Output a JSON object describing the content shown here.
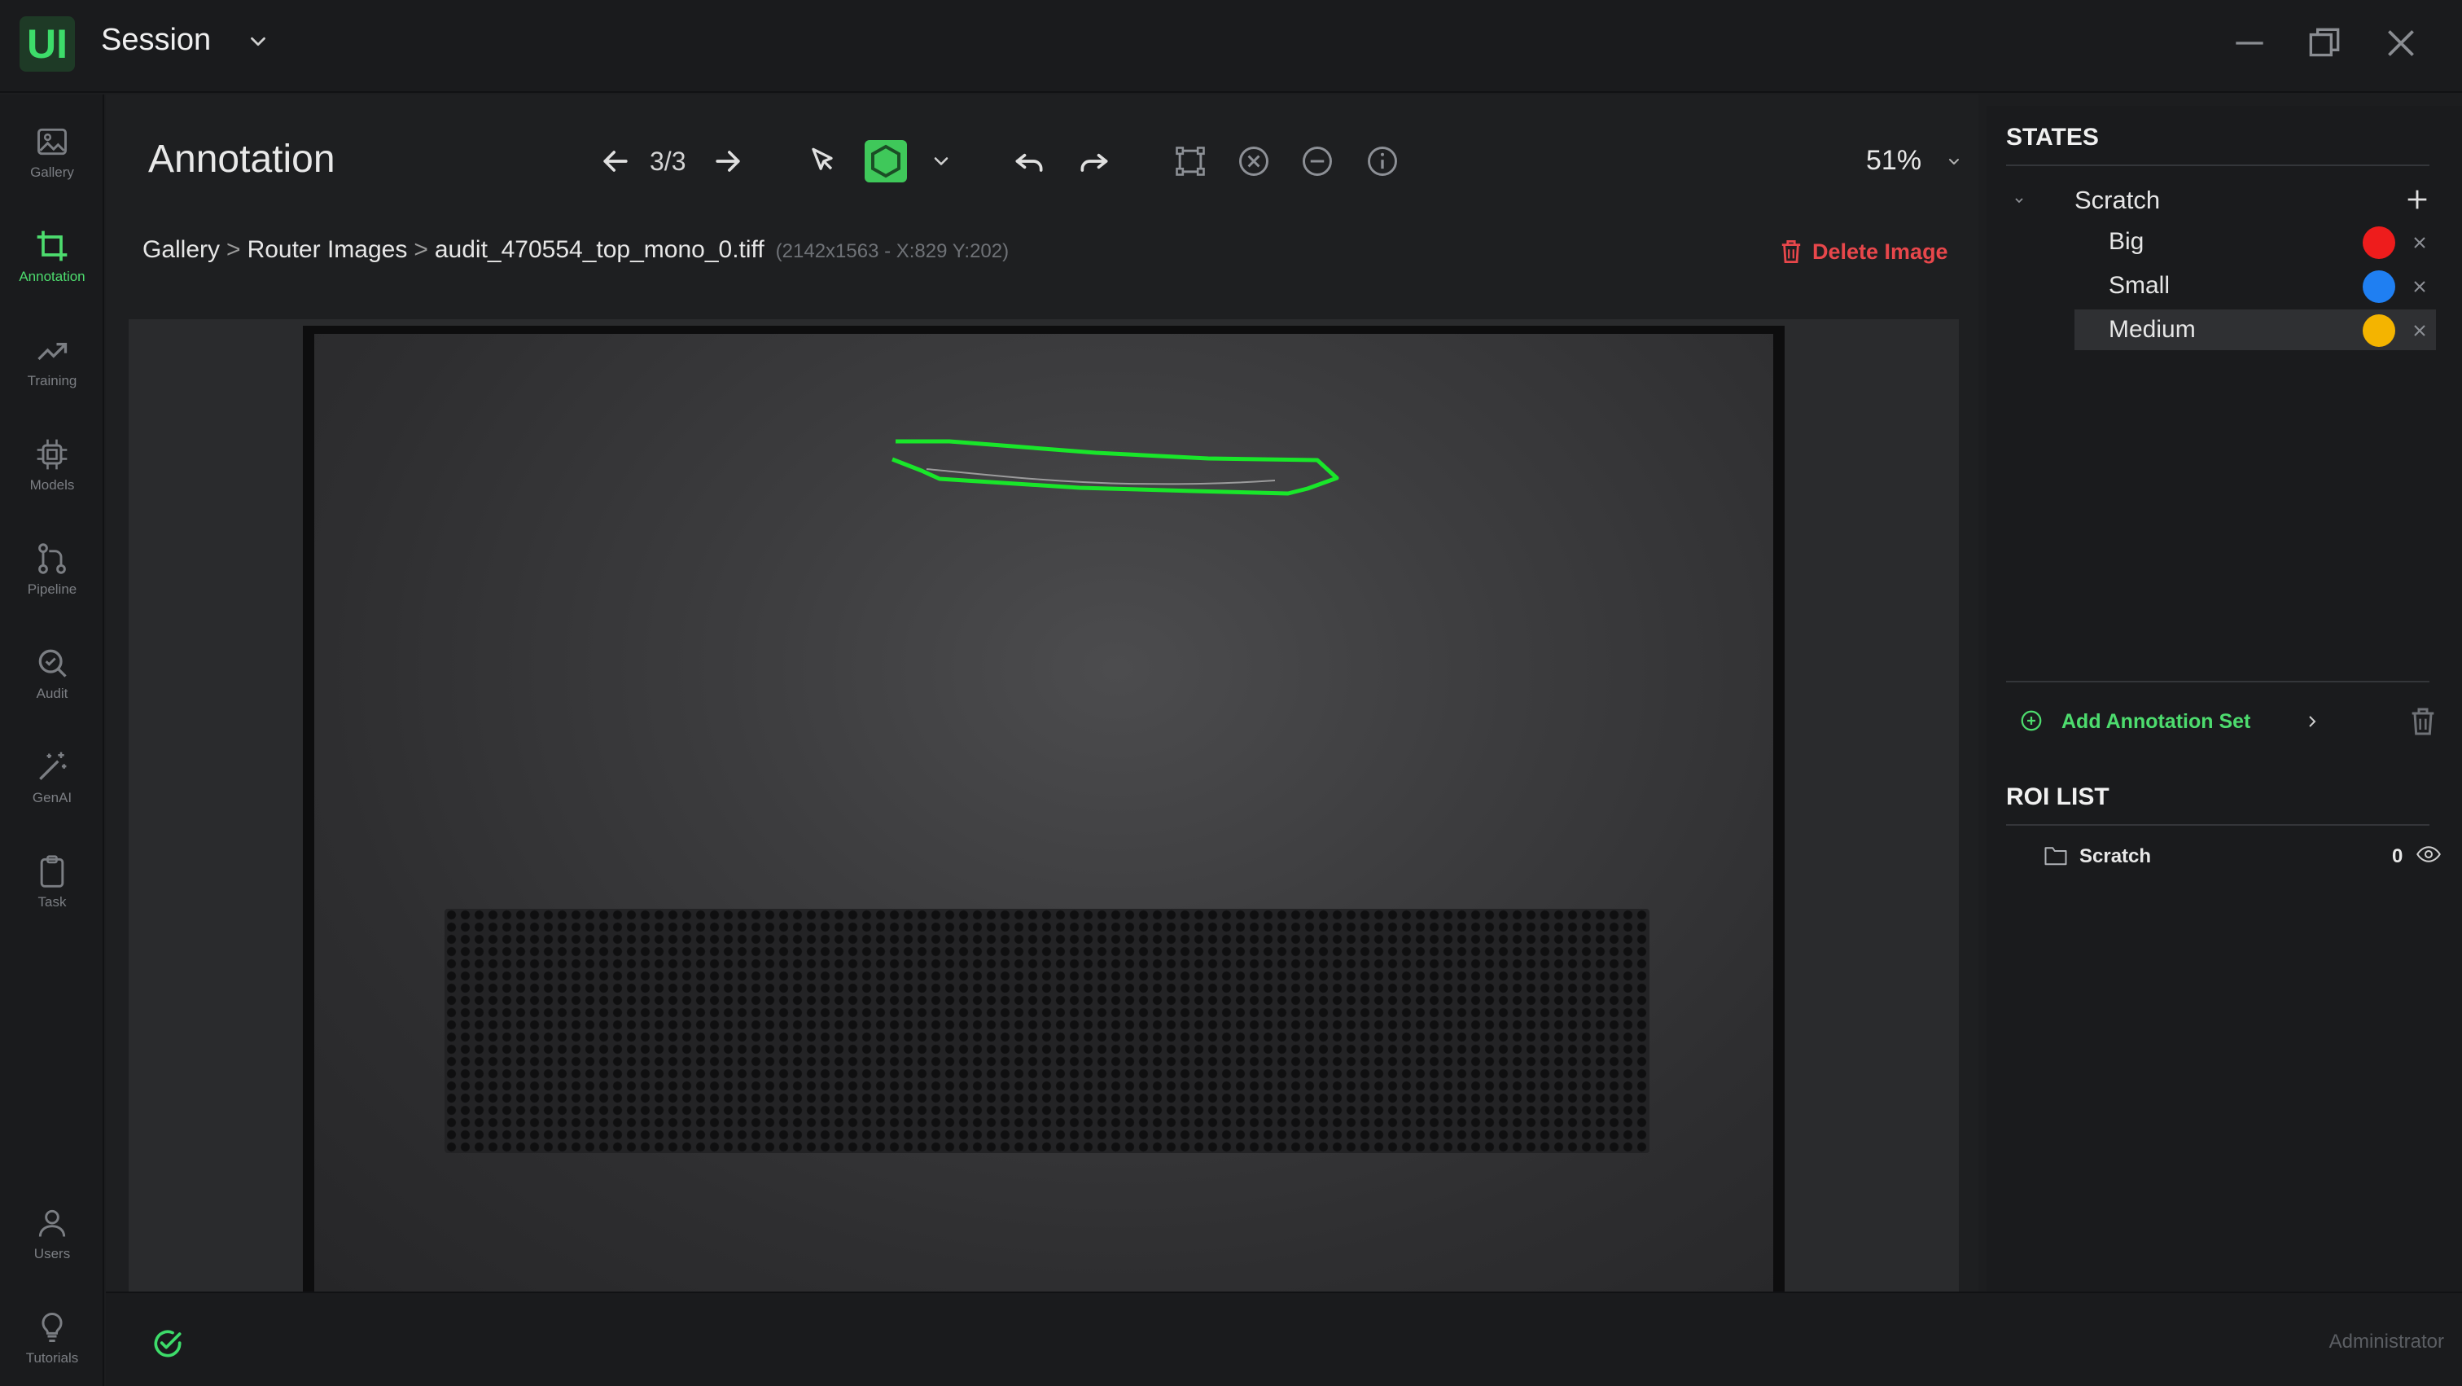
{
  "app": {
    "logo_text": "UI",
    "session_title": "Session"
  },
  "nav": {
    "gallery": "Gallery",
    "annotation": "Annotation",
    "training": "Training",
    "models": "Models",
    "pipeline": "Pipeline",
    "audit": "Audit",
    "genai": "GenAI",
    "task": "Task",
    "users": "Users",
    "tutorials": "Tutorials"
  },
  "header": {
    "title": "Annotation",
    "counter": "3/3",
    "zoom": "51%"
  },
  "breadcrumb": {
    "gallery": "Gallery",
    "folder": "Router Images",
    "file": "audit_470554_top_mono_0.tiff",
    "info": "(2142x1563 - X:829 Y:202)",
    "sep": ">"
  },
  "delete_label": "Delete Image",
  "states": {
    "title": "STATES",
    "group": "Scratch",
    "items": [
      {
        "name": "Big",
        "color": "#ee1c1c"
      },
      {
        "name": "Small",
        "color": "#1f7ff2"
      },
      {
        "name": "Medium",
        "color": "#f4b400"
      }
    ],
    "add_annotation_set": "Add Annotation Set"
  },
  "roi": {
    "title": "ROI LIST",
    "items": [
      {
        "name": "Scratch",
        "count": "0"
      }
    ]
  },
  "status": {
    "user": "Administrator"
  },
  "colors": {
    "accent": "#4ddc6e",
    "danger": "#e8474b",
    "polygon": "#19e62a"
  }
}
